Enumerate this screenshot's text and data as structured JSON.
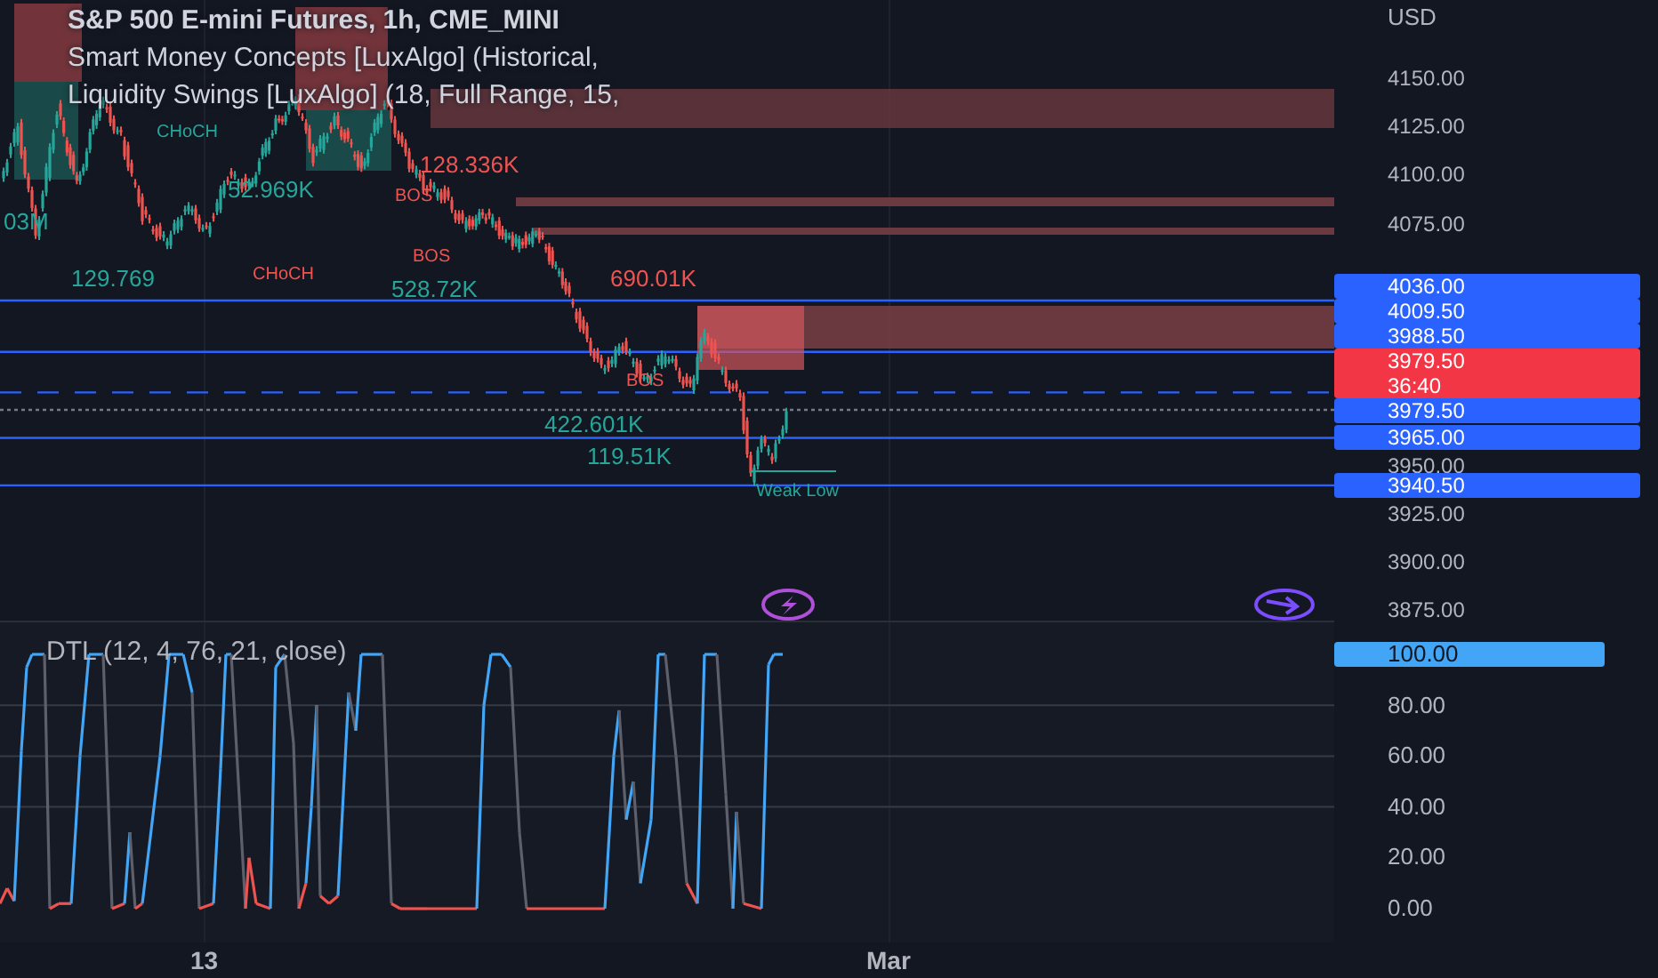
{
  "chart": {
    "legend": [
      "S&P 500 E-mini Futures, 1h, CME_MINI",
      "Smart Money Concepts [LuxAlgo] (Historical,",
      "Liquidity Swings [LuxAlgo] (18, Full Range, 15,"
    ],
    "labels": [
      {
        "text": "03M",
        "kind": "volume-up"
      },
      {
        "text": "CHoCH",
        "kind": "structure-up"
      },
      {
        "text": "52.969K",
        "kind": "volume-up"
      },
      {
        "text": "128.336K",
        "kind": "volume-down"
      },
      {
        "text": "BOS",
        "kind": "structure-down"
      },
      {
        "text": "BOS",
        "kind": "structure-down"
      },
      {
        "text": "129.769",
        "kind": "volume-up"
      },
      {
        "text": "CHoCH",
        "kind": "structure-down"
      },
      {
        "text": "528.72K",
        "kind": "volume-up"
      },
      {
        "text": "690.01K",
        "kind": "volume-down"
      },
      {
        "text": "BOS",
        "kind": "structure-down"
      },
      {
        "text": "422.601K",
        "kind": "volume-up"
      },
      {
        "text": "119.51K",
        "kind": "volume-up"
      },
      {
        "text": "Weak Low",
        "kind": "structure-up"
      }
    ],
    "currency": "USD",
    "price_ticks": [
      "4150.00",
      "4125.00",
      "4100.00",
      "4075.00",
      "3950.00",
      "3925.00",
      "3900.00",
      "3875.00"
    ],
    "price_labels": [
      {
        "text": "4036.00",
        "kind": "level"
      },
      {
        "text": "4009.50",
        "kind": "level"
      },
      {
        "text": "3988.50",
        "kind": "target"
      },
      {
        "text": "3979.50",
        "countdown": "36:40",
        "kind": "last"
      },
      {
        "text": "3979.50",
        "kind": "marker"
      },
      {
        "text": "3965.00",
        "kind": "level"
      },
      {
        "text": "3940.50",
        "kind": "level"
      }
    ]
  },
  "indicator": {
    "title": "DTL (12, 4, 76, 21, close)",
    "ticks": [
      {
        "text": "100.00",
        "kind": "current"
      },
      {
        "text": "80.00",
        "kind": "tick"
      },
      {
        "text": "60.00",
        "kind": "tick"
      },
      {
        "text": "40.00",
        "kind": "tick"
      },
      {
        "text": "20.00",
        "kind": "tick"
      },
      {
        "text": "0.00",
        "kind": "tick"
      }
    ]
  },
  "time_axis": [
    "13",
    "Mar"
  ]
}
